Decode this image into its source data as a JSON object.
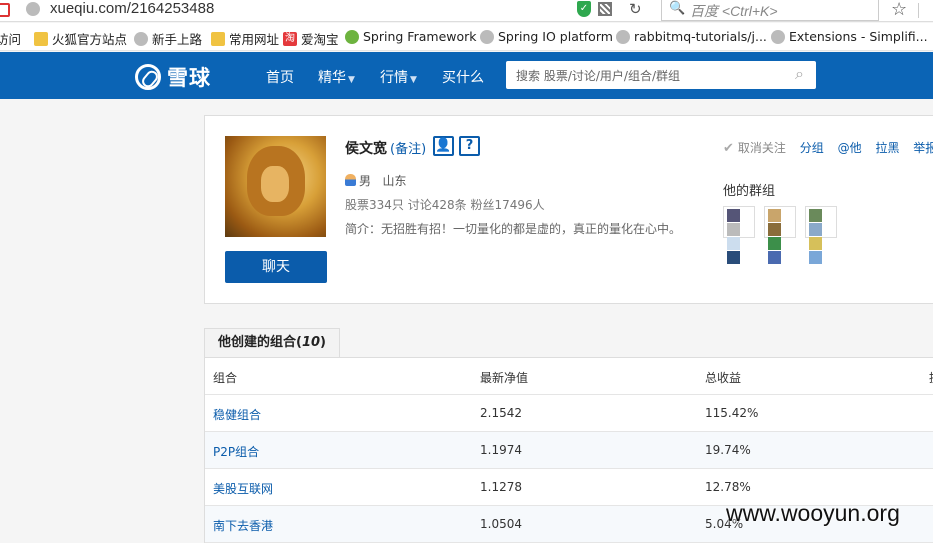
{
  "browser": {
    "url": "xueqiu.com/2164253488",
    "search_placeholder": "百度 <Ctrl+K>",
    "bookmarks": [
      "访问",
      "火狐官方站点",
      "新手上路",
      "常用网址",
      "爱淘宝",
      "Spring Framework",
      "Spring IO platform",
      "rabbitmq-tutorials/j...",
      "Extensions - Simplifi..."
    ]
  },
  "site": {
    "logo_text": "雪球",
    "nav": [
      "首页",
      "精华",
      "行情",
      "买什么"
    ],
    "search_placeholder": "搜索 股票/讨论/用户/组合/群组"
  },
  "profile": {
    "name": "侯文宽",
    "note_link": "(备注)",
    "gender": "男",
    "location": "山东",
    "stats": "股票334只  讨论428条  粉丝17496人",
    "bio": "简介：无招胜有招！一切量化的都是虚的，真正的量化在心中。",
    "chat_button": "聊天",
    "actions": {
      "unfollow": "取消关注",
      "group": "分组",
      "mention": "@他",
      "block": "拉黑",
      "report": "举报"
    },
    "groups_title": "他的群组"
  },
  "combos": {
    "tab_label_prefix": "他创建的组合(",
    "tab_count": "10",
    "tab_label_suffix": ")",
    "headers": [
      "组合",
      "最新净值",
      "总收益",
      "提"
    ],
    "rows": [
      {
        "name": "稳健组合",
        "nav": "2.1542",
        "return": "115.42%"
      },
      {
        "name": "P2P组合",
        "nav": "1.1974",
        "return": "19.74%"
      },
      {
        "name": "美股互联网",
        "nav": "1.1278",
        "return": "12.78%"
      },
      {
        "name": "南下去香港",
        "nav": "1.0504",
        "return": "5.04%"
      }
    ]
  },
  "watermark": "www.wooyun.org"
}
